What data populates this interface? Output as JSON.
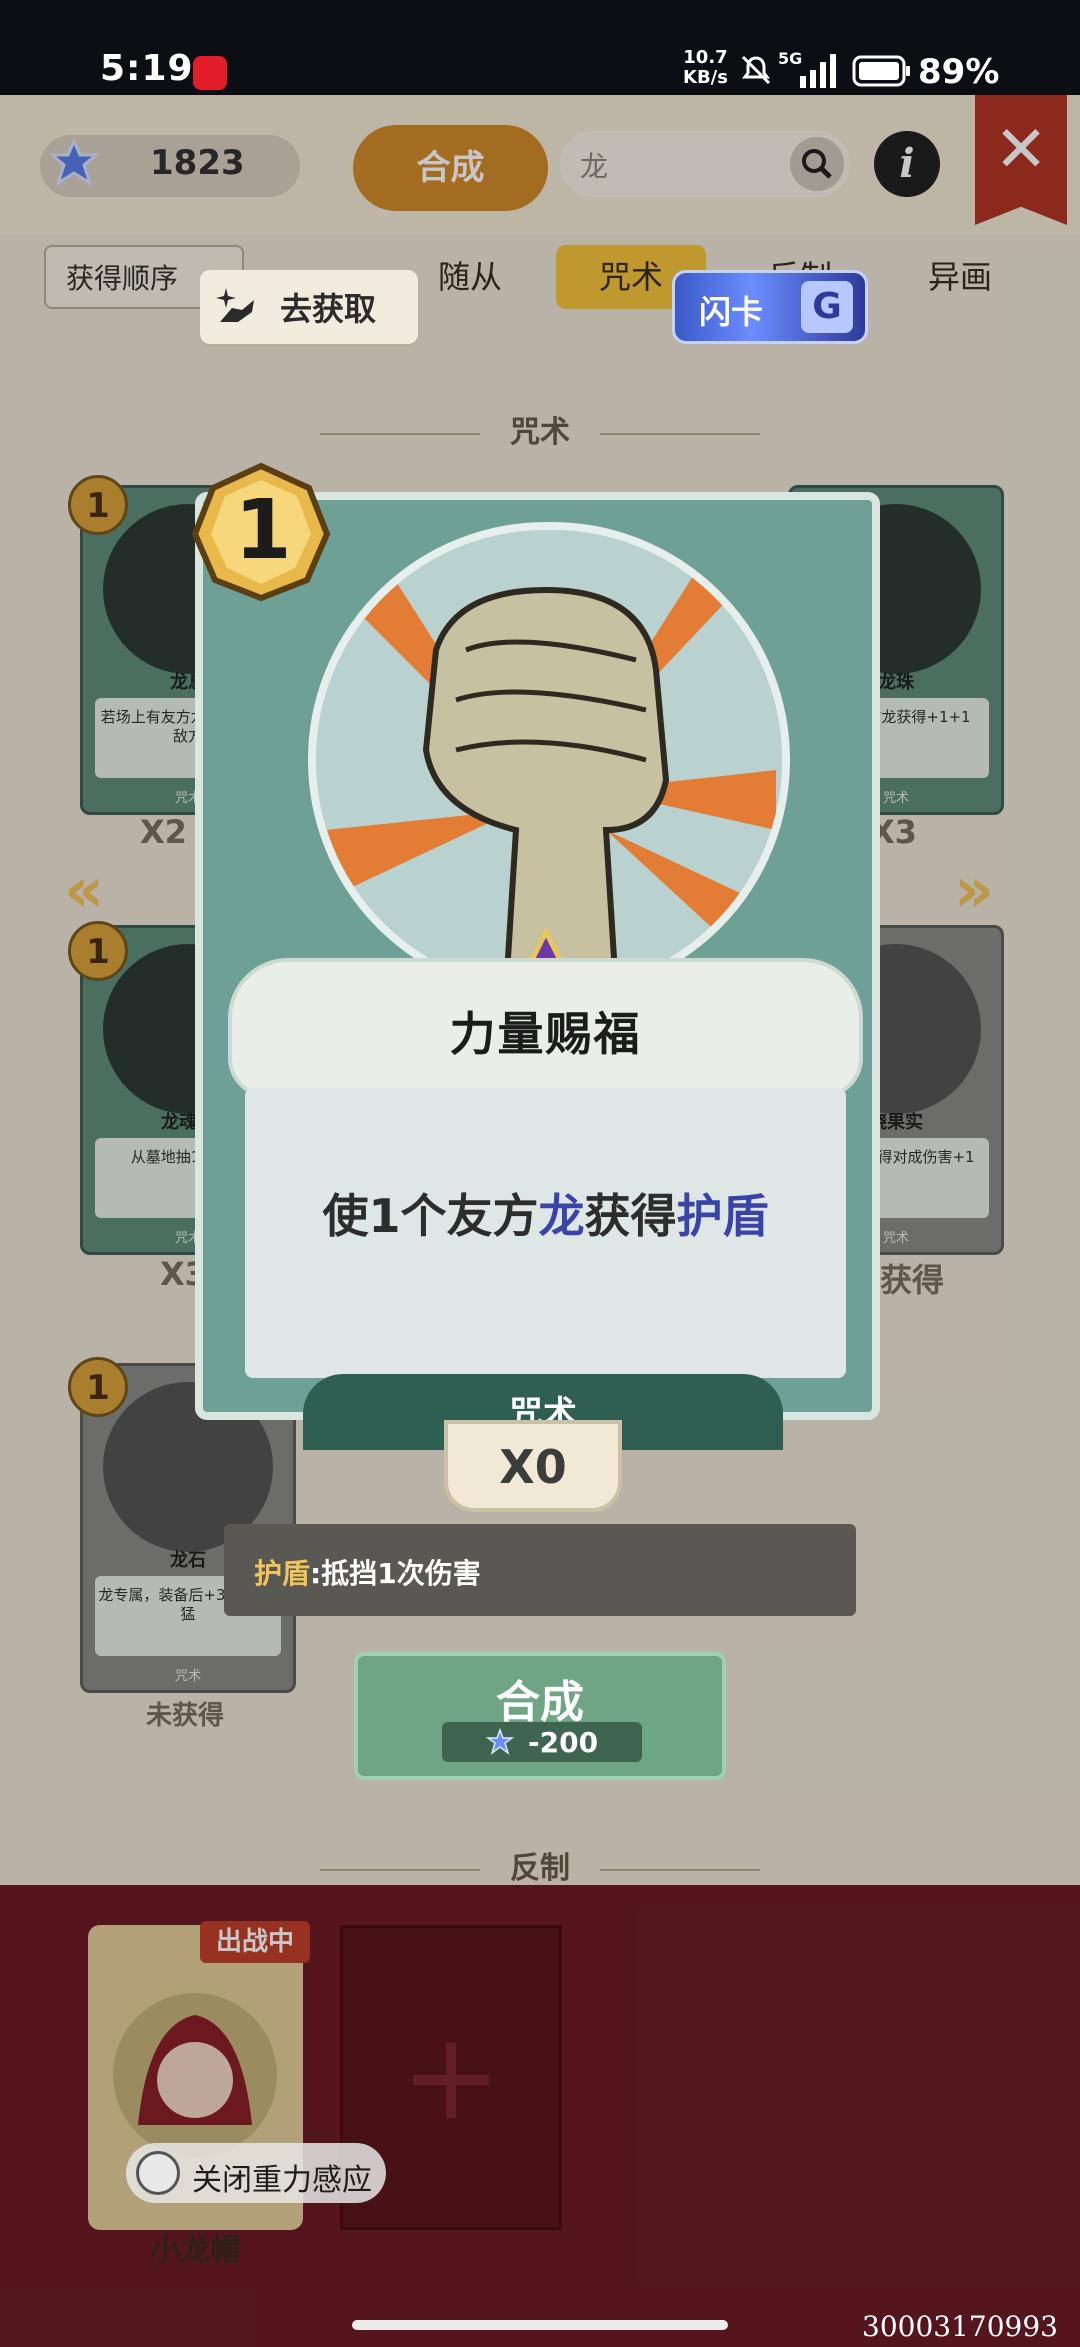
{
  "status_bar": {
    "time": "5:19",
    "net_speed_value": "10.7",
    "net_speed_unit": "KB/s",
    "network": "5G",
    "battery": "89%"
  },
  "header": {
    "gem_count": "1823",
    "compose_tab": "合成",
    "search_value": "龙",
    "info_label": "i"
  },
  "filters": {
    "sort": "获得顺序",
    "tabs": [
      "随从",
      "咒术",
      "反制",
      "异画"
    ],
    "active_tab": "咒术"
  },
  "section_titles": [
    "咒术",
    "反制"
  ],
  "grid_cards": [
    {
      "cost": "1",
      "name": "龙息",
      "desc": "若场上有友方龙机消灭1个敌方",
      "type": "咒术",
      "count": "X2"
    },
    {
      "cost": "1",
      "name": "龙珠",
      "desc": "所有友方龙获得+1+1",
      "type": "咒术",
      "count": "X3"
    },
    {
      "cost": "1",
      "name": "龙魂复",
      "desc": "从墓地抽1张龙随",
      "type": "咒术",
      "count": "X3"
    },
    {
      "cost": "",
      "name": "烧果实",
      "desc": "装备后获得对成伤害+1",
      "type": "咒术",
      "count": "获得"
    },
    {
      "cost": "1",
      "name": "龙石",
      "desc": "龙专属，装备后+3+3和勇猛",
      "type": "咒术",
      "count": "未获得"
    }
  ],
  "actions": {
    "get_label": "去获取",
    "flash_label": "闪卡",
    "flash_chip": "G"
  },
  "card": {
    "cost": "1",
    "name": "力量赐福",
    "desc_parts": [
      "使1个友方",
      "龙",
      "获得",
      "护盾"
    ],
    "type": "咒术",
    "owned": "X0"
  },
  "keyword": {
    "term": "护盾",
    "text": ":抵挡1次伤害"
  },
  "compose": {
    "label": "合成",
    "cost": "-200"
  },
  "deck": {
    "badge": "出战中",
    "hero_name": "小龙帽",
    "empty_slot": "+"
  },
  "gyro": {
    "label": "关闭重力感应"
  },
  "build_id": "30003170993",
  "colors": {
    "accent_orange": "#d38b2a",
    "card_green": "#6fa096",
    "highlight_blue": "#3a43a8",
    "keyword_gold": "#f2c45a",
    "panel_red": "#6c1d24"
  }
}
